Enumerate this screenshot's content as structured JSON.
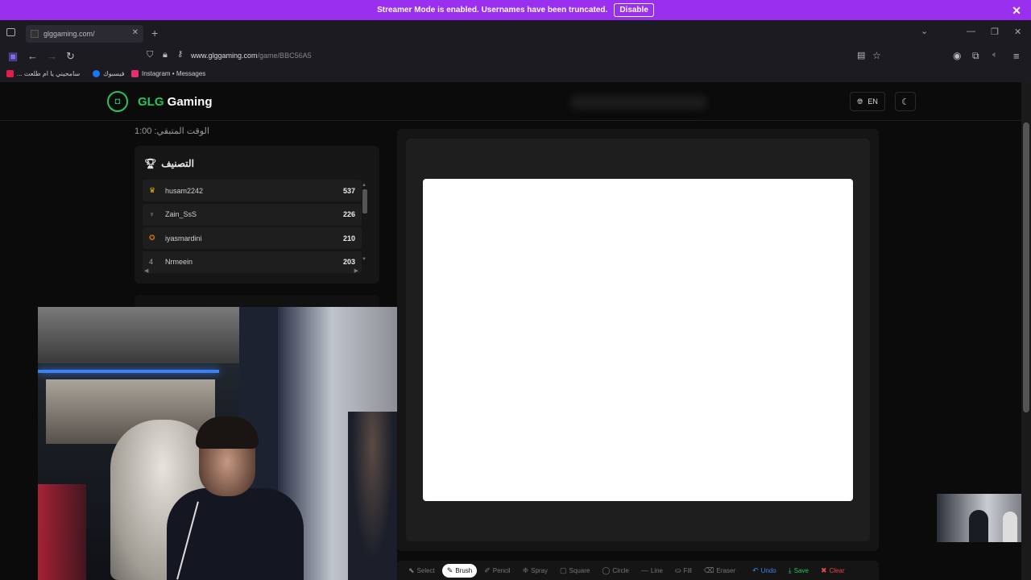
{
  "banner": {
    "message": "Streamer Mode is enabled. Usernames have been truncated.",
    "disable_label": "Disable",
    "close": "✕"
  },
  "browser": {
    "tab_title": "glggaming.com/",
    "url_domain": "www.glggaming.com",
    "url_path": "/game/BBC56A5",
    "bookmarks": [
      {
        "label": "... سامحيني يا ام طلعت",
        "color": "#e11d48"
      },
      {
        "label": "فيسبوك",
        "color": "#1877f2"
      },
      {
        "label": "Instagram • Messages",
        "color": "#e1306c"
      }
    ]
  },
  "header": {
    "brand_prefix": "GLG",
    "brand_suffix": " Gaming",
    "lang": "EN"
  },
  "timer": "الوقت المتبقي: 1:00",
  "ranking": {
    "title": "التصنيف",
    "players": [
      {
        "name": "husam2242",
        "score": "537",
        "icon": "crown-icon",
        "color": "#eab308"
      },
      {
        "name": "Zain_SsS",
        "score": "226",
        "icon": "trophy-icon",
        "color": "#9ca3af"
      },
      {
        "name": "iyasmardini",
        "score": "210",
        "icon": "medal-icon",
        "color": "#d97706"
      },
      {
        "name": "Nrmeein",
        "score": "203",
        "icon": "rank-4-icon",
        "color": "#9ca3af"
      }
    ]
  },
  "tools": [
    {
      "key": "select",
      "label": "Select",
      "icon": "⬉"
    },
    {
      "key": "brush",
      "label": "Brush",
      "icon": "✎",
      "active": true
    },
    {
      "key": "pencil",
      "label": "Pencil",
      "icon": "✐"
    },
    {
      "key": "spray",
      "label": "Spray",
      "icon": "❈"
    },
    {
      "key": "square",
      "label": "Square",
      "icon": "▢"
    },
    {
      "key": "circle",
      "label": "Circle",
      "icon": "◯"
    },
    {
      "key": "line",
      "label": "Line",
      "icon": "—"
    },
    {
      "key": "fill",
      "label": "Fill",
      "icon": "⛀"
    },
    {
      "key": "eraser",
      "label": "Eraser",
      "icon": "⌫"
    },
    {
      "key": "undo",
      "label": "Undo",
      "icon": "↶"
    },
    {
      "key": "save",
      "label": "Save",
      "icon": "⤓"
    },
    {
      "key": "clear",
      "label": "Clear",
      "icon": "🗑"
    }
  ]
}
